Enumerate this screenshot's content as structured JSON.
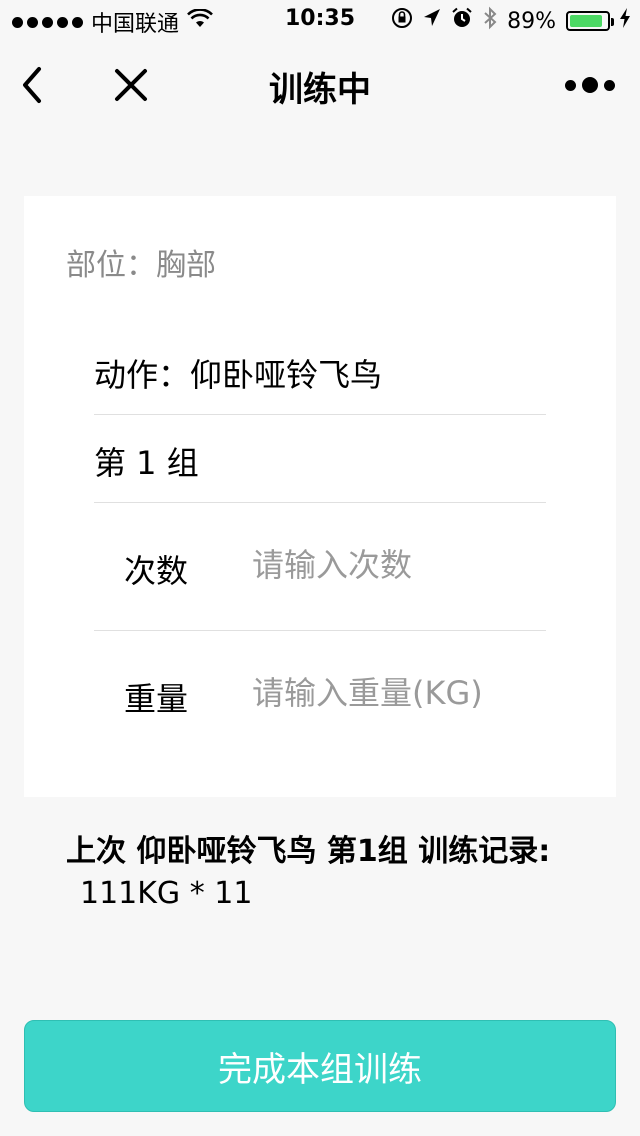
{
  "status_bar": {
    "carrier": "中国联通",
    "time": "10:35",
    "battery": "89%",
    "battery_level": 0.89,
    "battery_color": "#4cd964"
  },
  "nav": {
    "title": "训练中",
    "back_icon": "chevron-left-icon",
    "close_icon": "close-icon",
    "more_icon": "more-dots-icon"
  },
  "card": {
    "body_part": "部位：胸部",
    "action": "动作：仰卧哑铃飞鸟",
    "group": "第 1 组",
    "reps": {
      "label": "次数",
      "placeholder": "请输入次数",
      "value": ""
    },
    "weight": {
      "label": "重量",
      "placeholder": "请输入重量(KG)",
      "value": ""
    }
  },
  "last_record": {
    "title": "上次 仰卧哑铃飞鸟 第1组 训练记录:",
    "value": "111KG * 11"
  },
  "complete_button": {
    "label": "完成本组训练",
    "color": "#3dd5c9"
  }
}
